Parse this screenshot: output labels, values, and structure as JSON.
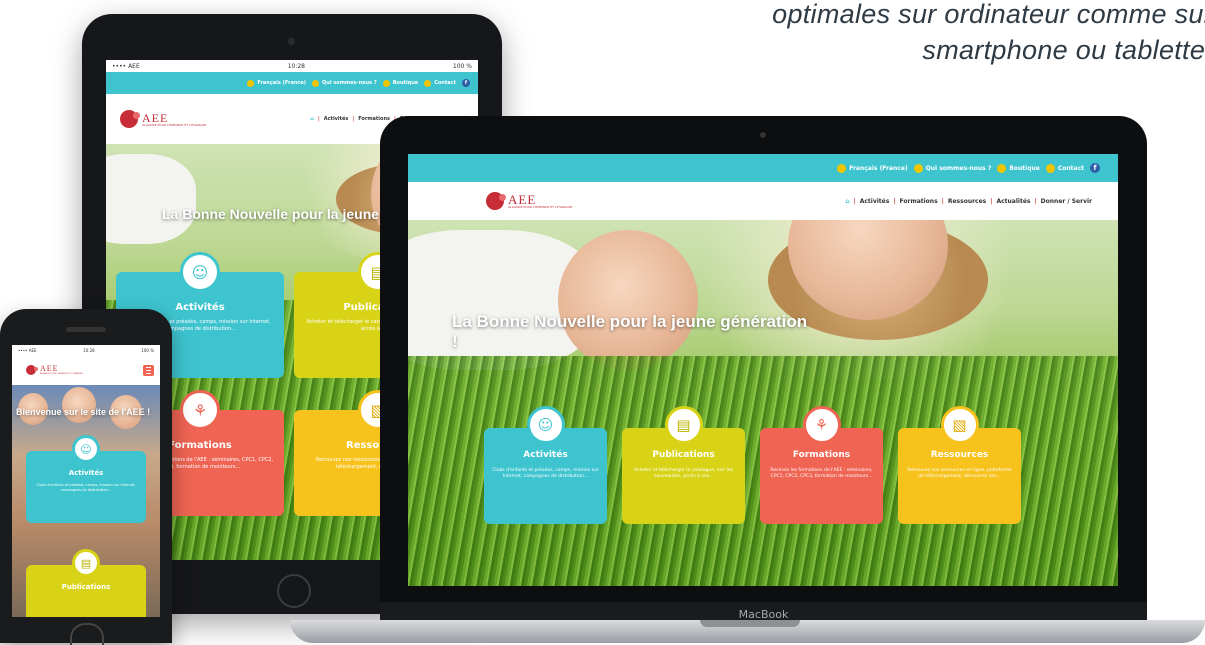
{
  "tagline": {
    "line1": "optimales sur ordinateur comme sur",
    "line2": "smartphone ou tablette"
  },
  "laptop": {
    "brand_label": "MacBook"
  },
  "site": {
    "topbar_links": [
      {
        "label": "Français (France)",
        "icon": "globe-icon"
      },
      {
        "label": "Qui sommes-nous ?",
        "icon": "info-icon"
      },
      {
        "label": "Boutique",
        "icon": "cart-icon"
      },
      {
        "label": "Contact",
        "icon": "mail-icon"
      }
    ],
    "logo": {
      "name": "AEE",
      "subtitle": "ALLIANCE POUR L'ENFANCE ET L'ÉVANGILE"
    },
    "nav": {
      "home_icon": "home-icon",
      "items": [
        "Activités",
        "Formations",
        "Ressources",
        "Actualités",
        "Donner / Servir"
      ]
    },
    "hero_title": "La Bonne Nouvelle pour la jeune génération !",
    "phone_hero_title": "Bienvenue sur le site de l'AEE !",
    "cards": [
      {
        "key": "activites",
        "title": "Activités",
        "desc": "Clubs d'enfants et préados, camps, mission sur Internet, campagnes de distribution...",
        "icon": "child-face-icon"
      },
      {
        "key": "publications",
        "title": "Publications",
        "desc": "Acheter et télécharger le catalogue, voir les nouveautés, accès à vos...",
        "icon": "book-icon"
      },
      {
        "key": "formations",
        "title": "Formations",
        "desc": "Recevez les formations de l'AEE : séminaires, CPC1, CPC2, CPC3, formation de moniteurs...",
        "icon": "wheat-icon"
      },
      {
        "key": "ressources",
        "title": "Ressources",
        "desc": "Retrouvez nos ressources en ligne, plateforme de téléchargement, découvrez nos...",
        "icon": "document-icon"
      }
    ]
  },
  "status": {
    "carrier": "•••• AEE",
    "time": "10:28",
    "battery": "100 %"
  },
  "colors": {
    "teal": "#3ec4cf",
    "lime": "#d9d318",
    "coral": "#ef6453",
    "yellow": "#f7c21c",
    "brand_red": "#c62d37"
  }
}
